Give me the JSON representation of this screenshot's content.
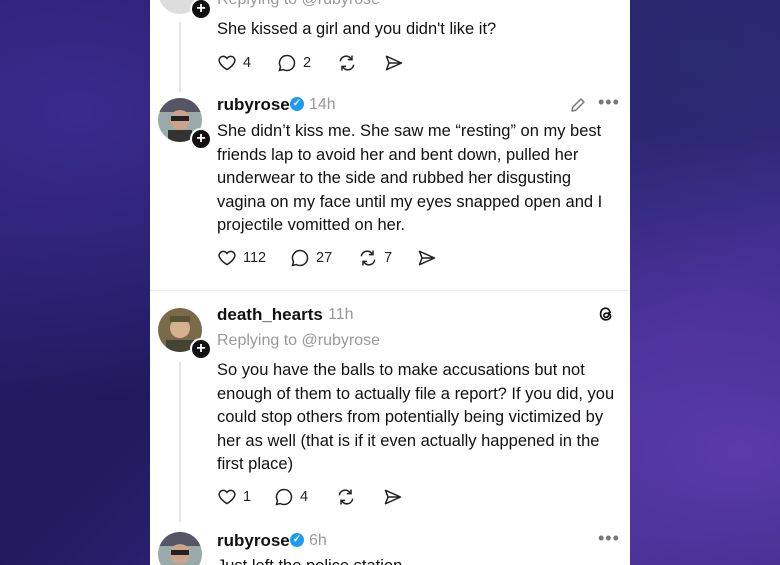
{
  "posts": [
    {
      "reply_to": "Replying to @rubyrose",
      "text": "She kissed a girl and you didn't like it?",
      "likes": "4",
      "comments": "2"
    },
    {
      "username": "rubyrose",
      "time": "14h",
      "text": "She didn’t kiss me. She saw me “resting” on my best friends lap to avoid her and bent down, pulled her underwear to the side and rubbed her disgusting vagina on my face until my eyes snapped open and I projectile vomitted on her.",
      "likes": "112",
      "comments": "27",
      "reposts": "7"
    },
    {
      "username": "death_hearts",
      "time": "11h",
      "reply_to": "Replying to @rubyrose",
      "text": "So you have the balls to make accusations but not enough of them to actually file a report? If you did, you could stop others from potentially being victimized by her as well (that is if it even actually happened in the first place)",
      "likes": "1",
      "comments": "4"
    },
    {
      "username": "rubyrose",
      "time": "6h",
      "text": "Just left the police station"
    }
  ],
  "icons": {
    "like": "heart-icon",
    "comment": "comment-icon",
    "repost": "repost-icon",
    "share": "share-icon",
    "edit": "pencil-icon",
    "more": "more-icon",
    "threads": "threads-logo-icon",
    "verified": "verified-badge-icon"
  },
  "colors": {
    "verified": "#1d9bf0",
    "muted_text": "#999999"
  }
}
